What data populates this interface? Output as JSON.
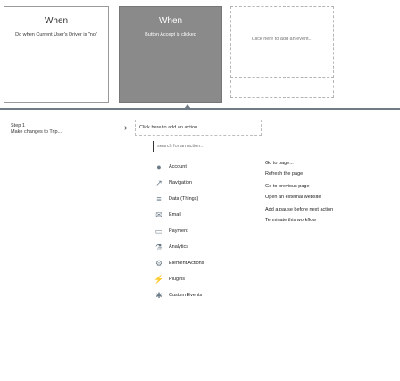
{
  "events": [
    {
      "title": "When",
      "desc": "Do when Current User's Driver is \"no\""
    },
    {
      "title": "When",
      "desc": "Button Accept is clicked"
    },
    {
      "title": "",
      "desc": "Click here to add an event..."
    }
  ],
  "step": {
    "label": "Step 1",
    "name": "Make changes to Trip...",
    "action_placeholder": "Click here to add an action..."
  },
  "search": {
    "placeholder": "search for an action..."
  },
  "menu": [
    {
      "label": "Account",
      "icon": "account-icon",
      "glyph": "👤"
    },
    {
      "label": "Navigation",
      "icon": "navigation-icon",
      "glyph": "↗"
    },
    {
      "label": "Data (Things)",
      "icon": "data-icon",
      "glyph": "≡"
    },
    {
      "label": "Email",
      "icon": "email-icon",
      "glyph": "✉"
    },
    {
      "label": "Payment",
      "icon": "payment-icon",
      "glyph": "▭"
    },
    {
      "label": "Analytics",
      "icon": "analytics-icon",
      "glyph": "⚗"
    },
    {
      "label": "Element Actions",
      "icon": "element-actions-icon",
      "glyph": "⚙"
    },
    {
      "label": "Plugins",
      "icon": "plugins-icon",
      "glyph": "⚡"
    },
    {
      "label": "Custom Events",
      "icon": "custom-events-icon",
      "glyph": "✱"
    }
  ],
  "submenu": [
    "Go to page...",
    "Refresh the page",
    "Go to previous page",
    "Open an external website",
    "Add a pause before next action",
    "Terminate this workflow"
  ]
}
